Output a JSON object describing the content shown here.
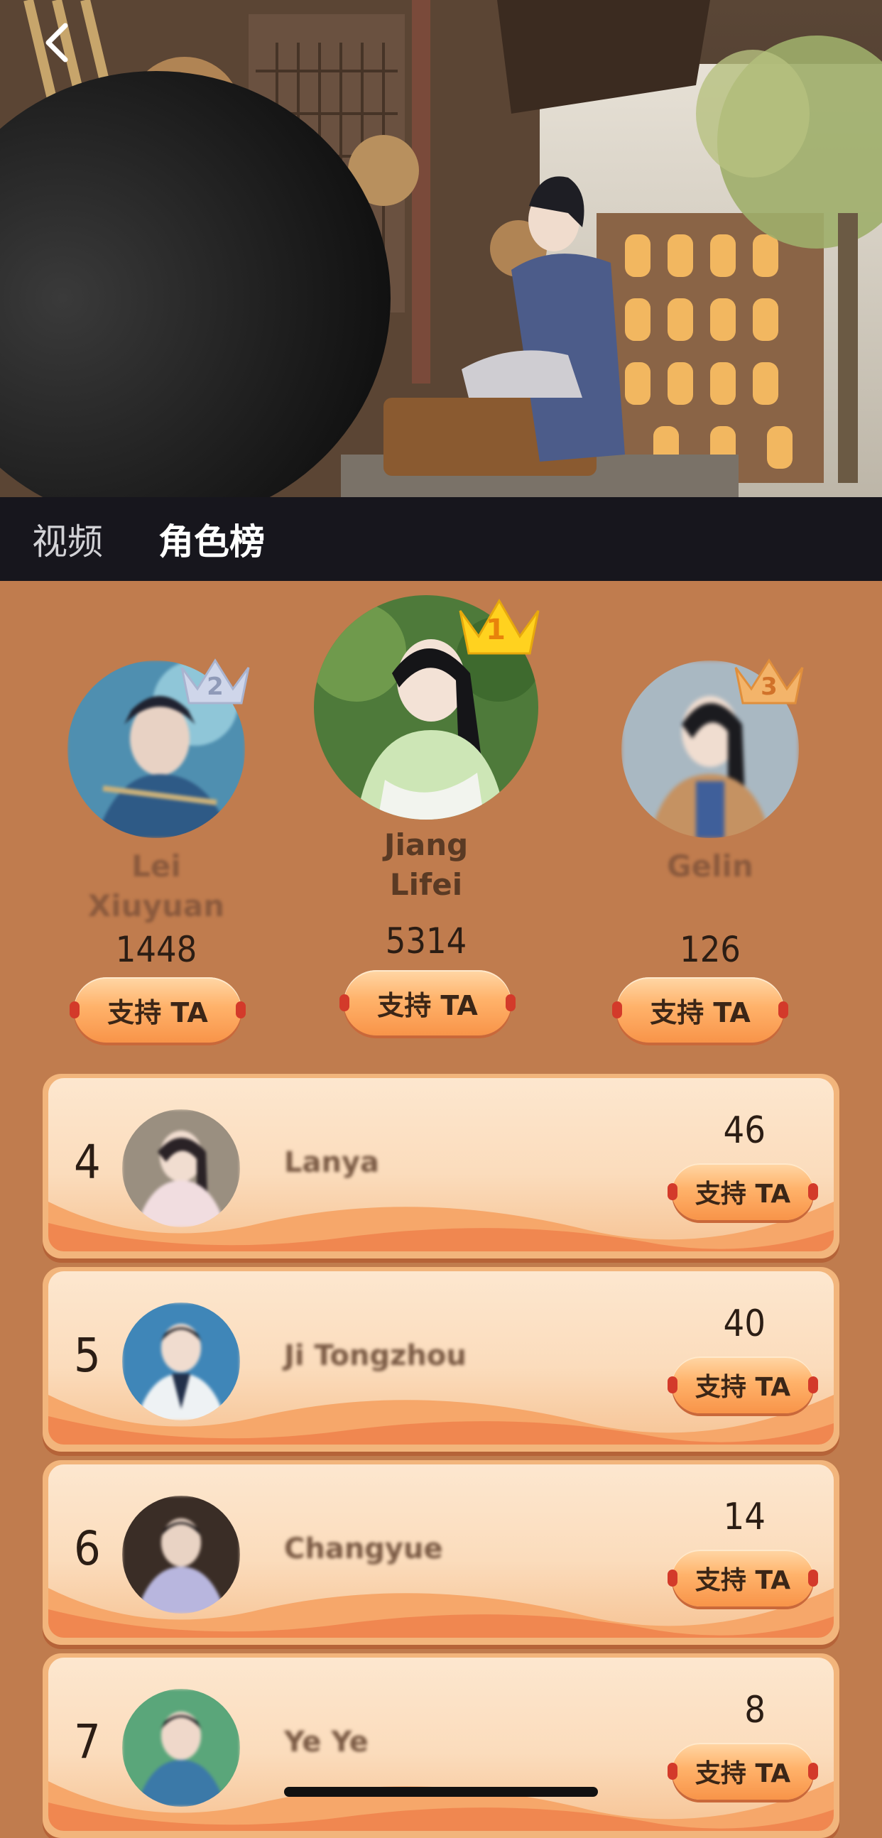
{
  "tabs": [
    {
      "label": "视频",
      "active": false
    },
    {
      "label": "角色榜",
      "active": true
    }
  ],
  "podium": [
    {
      "rank": 2,
      "name": "Lei Xiuyuan",
      "name_lines": [
        "Lei",
        "Xiuyuan"
      ],
      "score": "1448",
      "button": "支持 TA"
    },
    {
      "rank": 1,
      "name": "Jiang Lifei",
      "name_lines": [
        "Jiang",
        "Lifei"
      ],
      "score": "5314",
      "button": "支持 TA"
    },
    {
      "rank": 3,
      "name": "Gelin",
      "name_lines": [
        "Gelin"
      ],
      "score": "126",
      "button": "支持 TA"
    }
  ],
  "list": [
    {
      "rank": "4",
      "name": "Lanya",
      "score": "46",
      "button": "支持 TA"
    },
    {
      "rank": "5",
      "name": "Ji Tongzhou",
      "score": "40",
      "button": "支持 TA"
    },
    {
      "rank": "6",
      "name": "Changyue",
      "score": "14",
      "button": "支持 TA"
    },
    {
      "rank": "7",
      "name": "Ye Ye",
      "score": "8",
      "button": "支持 TA"
    }
  ],
  "icons": {
    "back": "chevron-left-icon",
    "crown": "crown-icon"
  },
  "colors": {
    "background": "#c07c4e",
    "tabbar": "#17161d",
    "button_gradient_top": "#ffd7a6",
    "button_gradient_bottom": "#f89449",
    "crown_gold": "#ffd21f",
    "crown_silver": "#cfd6ea",
    "crown_bronze": "#f3b46a"
  }
}
